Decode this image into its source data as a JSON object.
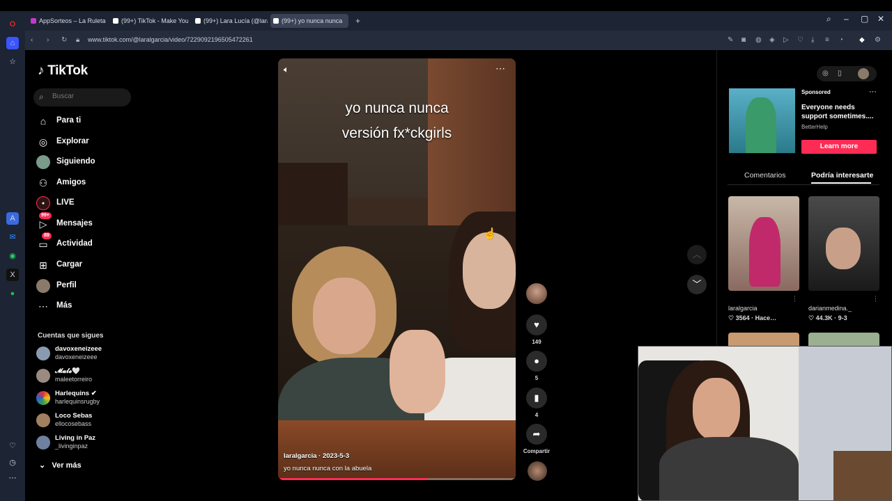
{
  "browser": {
    "tabs": [
      {
        "label": "AppSorteos – La Ruleta de",
        "color": "#c13ac8",
        "active": false
      },
      {
        "label": "(99+) TikTok - Make Your D",
        "color": "#ffffff",
        "active": false
      },
      {
        "label": "(99+) Lara Lucía (@laralga",
        "color": "#ffffff",
        "active": false
      },
      {
        "label": "(99+) yo nunca nunca",
        "color": "#ffffff",
        "active": true
      }
    ],
    "url": "www.tiktok.com/@laralgarcia/video/7229092196505472261"
  },
  "tiktok": {
    "logo": "TikTok",
    "search_placeholder": "Buscar",
    "nav": [
      {
        "label": "Para ti",
        "icon": "home-icon"
      },
      {
        "label": "Explorar",
        "icon": "compass-icon"
      },
      {
        "label": "Siguiendo",
        "icon": "following-avatar-icon"
      },
      {
        "label": "Amigos",
        "icon": "friends-icon"
      },
      {
        "label": "LIVE",
        "icon": "live-icon"
      },
      {
        "label": "Mensajes",
        "icon": "messages-icon",
        "badge": "99+"
      },
      {
        "label": "Actividad",
        "icon": "activity-icon",
        "badge": "89"
      },
      {
        "label": "Cargar",
        "icon": "upload-icon"
      },
      {
        "label": "Perfil",
        "icon": "profile-avatar-icon"
      },
      {
        "label": "Más",
        "icon": "more-icon"
      }
    ],
    "following_title": "Cuentas que sigues",
    "following": [
      {
        "name": "davoxeneizeee",
        "handle": "davoxeneizeee",
        "color": "#8a9ab0"
      },
      {
        "name": "𝓜𝓪𝓵𝓮🤍",
        "handle": "maleetorreiro",
        "color": "#9a8a80"
      },
      {
        "name": "Harlequins ✔",
        "handle": "harlequinsrugby",
        "color": "#3aa060"
      },
      {
        "name": "Loco Sebas",
        "handle": "ellocosebass",
        "color": "#a08060"
      },
      {
        "name": "Living in Paz",
        "handle": "_livinginpaz",
        "color": "#7080a0"
      }
    ],
    "see_more": "Ver más"
  },
  "video": {
    "overlay_line1": "yo nunca nunca",
    "overlay_line2": "versión fx*ckgirls",
    "author_date": "laralgarcia · 2023-5-3",
    "description": "yo nunca nunca con la abuela",
    "progress": 0.63,
    "likes": "149",
    "comments": "5",
    "saves": "4",
    "share_label": "Compartir"
  },
  "right_panel": {
    "ad": {
      "sponsored": "Sponsored",
      "headline": "Everyone needs support sometimes....",
      "brand": "BetterHelp",
      "cta": "Learn more"
    },
    "tab_comments": "Comentarios",
    "tab_interest": "Podría interesarte",
    "thumbs": [
      {
        "author": "laralgarcia",
        "stats": "♡ 3564 · Hace…",
        "bg": "#b8a898"
      },
      {
        "author": "darianmedina._",
        "stats": "♡ 44.3K · 9-3",
        "bg": "#3a3a3a"
      }
    ]
  }
}
